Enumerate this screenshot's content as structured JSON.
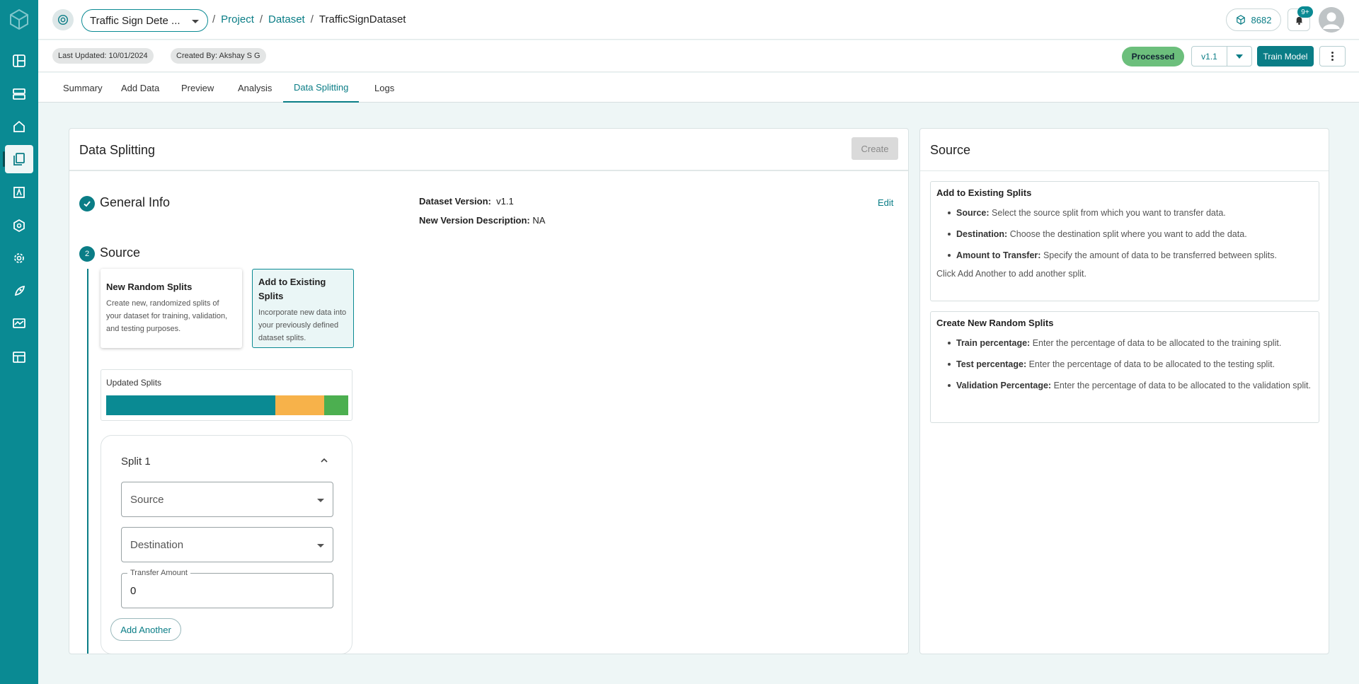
{
  "header": {
    "project_name": "Traffic Sign Dete ...",
    "breadcrumbs": [
      {
        "label": "Project",
        "link": true
      },
      {
        "label": "Dataset",
        "link": true
      },
      {
        "label": "TrafficSignDataset",
        "link": false
      }
    ],
    "credits": "8682",
    "notifications_badge": "9+"
  },
  "subheader": {
    "last_updated": "Last Updated: 10/01/2024",
    "created_by": "Created By: Akshay S G",
    "status": "Processed",
    "version": "v1.1",
    "train_button": "Train Model"
  },
  "tabs": [
    "Summary",
    "Add Data",
    "Preview",
    "Analysis",
    "Data Splitting",
    "Logs"
  ],
  "active_tab": "Data Splitting",
  "main": {
    "title": "Data Splitting",
    "create_button": "Create",
    "general_info": {
      "title": "General Info",
      "dataset_version_label": "Dataset Version:",
      "dataset_version_value": "v1.1",
      "description_label": "New Version Description:",
      "description_value": "NA",
      "edit_label": "Edit"
    },
    "source": {
      "step_number": "2",
      "title": "Source",
      "options": [
        {
          "title": "New Random Splits",
          "description": "Create new, randomized splits of your dataset for training, validation, and testing purposes.",
          "selected": false
        },
        {
          "title": "Add to Existing Splits",
          "description": "Incorporate new data into your previously defined dataset splits.",
          "selected": true
        }
      ],
      "updated_splits_label": "Updated Splits",
      "split_bar": [
        {
          "fraction": 0.7,
          "color": "#0a8a93"
        },
        {
          "fraction": 0.2,
          "color": "#f7b24a"
        },
        {
          "fraction": 0.1,
          "color": "#4caf50"
        }
      ],
      "split": {
        "title": "Split 1",
        "source_placeholder": "Source",
        "destination_placeholder": "Destination",
        "transfer_label": "Transfer Amount",
        "transfer_value": "0",
        "add_another": "Add Another"
      }
    }
  },
  "side": {
    "title": "Source",
    "existing": {
      "heading": "Add to Existing Splits",
      "items": [
        {
          "term": "Source:",
          "text": "Select the source split from which you want to transfer data."
        },
        {
          "term": "Destination:",
          "text": "Choose the destination split where you want to add the data."
        },
        {
          "term": "Amount to Transfer:",
          "text": "Specify the amount of data to be transferred between splits."
        }
      ],
      "note": "Click Add Another to add another split."
    },
    "random": {
      "heading": "Create New Random Splits",
      "items": [
        {
          "term": "Train percentage:",
          "text": "Enter the percentage of data to be allocated to the training split."
        },
        {
          "term": "Test percentage:",
          "text": "Enter the percentage of data to be allocated to the testing split."
        },
        {
          "term": "Validation Percentage:",
          "text": "Enter the percentage of data to be allocated to the validation split."
        }
      ]
    }
  }
}
